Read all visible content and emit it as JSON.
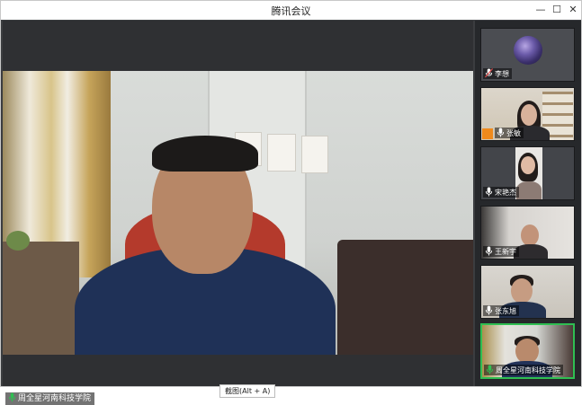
{
  "window": {
    "title": "腾讯会议",
    "controls": {
      "minimize": "—",
      "maximize": "☐",
      "close": "✕"
    }
  },
  "main_video": {
    "speaker_label": "周全星河南科技学院",
    "tooltip": "截图(Alt + A)"
  },
  "participants": [
    {
      "name": "李想",
      "mic": "muted"
    },
    {
      "name": "张敏",
      "mic": "on"
    },
    {
      "name": "宋艳杰",
      "mic": "on"
    },
    {
      "name": "王新宇",
      "mic": "on"
    },
    {
      "name": "张东旭",
      "mic": "on"
    },
    {
      "name": "周全星河南科技学院",
      "mic": "on",
      "active": true
    }
  ],
  "colors": {
    "active_speaker_border": "#2fbf52",
    "mic_on": "#ffffff",
    "mic_active": "#2fbf52",
    "mic_muted": "#e04b4b"
  }
}
